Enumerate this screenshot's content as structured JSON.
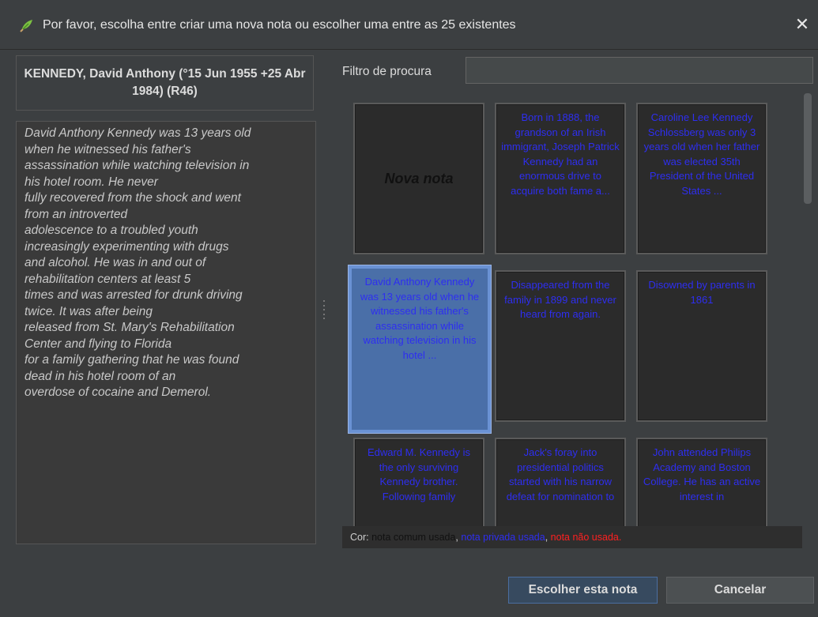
{
  "window": {
    "title": "Por favor, escolha entre criar uma nova nota ou escolher uma entre as 25 existentes",
    "close_glyph": "✕",
    "icon": "leaf-icon"
  },
  "person": {
    "header": "KENNEDY, David Anthony (°15 Jun 1955 +25 Abr 1984) (R46)",
    "note_text": "David Anthony Kennedy was 13 years old\nwhen he witnessed his father's\nassassination while watching television in\nhis hotel room.  He never\nfully recovered from the shock and went\nfrom an introverted\nadolescence to a troubled youth\nincreasingly experimenting with drugs\nand alcohol.  He was in and out of\nrehabilitation centers at least 5\ntimes and was arrested for drunk driving\ntwice.  It was after being\nreleased from St. Mary's Rehabilitation\nCenter and flying to Florida\nfor a family gathering that he was found\ndead in his hotel room of an\noverdose of cocaine and Demerol."
  },
  "filter": {
    "label": "Filtro de procura",
    "value": ""
  },
  "cards": {
    "new_note": "Nova nota",
    "items": [
      "Born in 1888, the grandson of an Irish immigrant, Joseph Patrick Kennedy had an enormous drive to acquire both fame a...",
      "Caroline Lee Kennedy Schlossberg was only 3 years old when her father was elected 35th President of the United States ...",
      "David Anthony Kennedy was 13 years old when he witnessed his father's assassination while watching television in his hotel ...",
      "Disappeared from the family in 1899 and never heard from again.",
      "Disowned by parents in 1861",
      "Edward M. Kennedy is the only surviving Kennedy brother. Following family",
      "Jack's foray into presidential politics started with his narrow defeat for nomination to",
      "John attended Philips Academy and Boston College. He has an active interest in"
    ]
  },
  "legend": {
    "label": "Cor:",
    "common": "nota comum usada",
    "private": "nota privada usada",
    "unused": "nota não usada",
    "colors": {
      "common": "#111111",
      "private": "#2e2ef0",
      "unused": "#ff2020"
    }
  },
  "buttons": {
    "choose": "Escolher esta nota",
    "cancel": "Cancelar"
  }
}
